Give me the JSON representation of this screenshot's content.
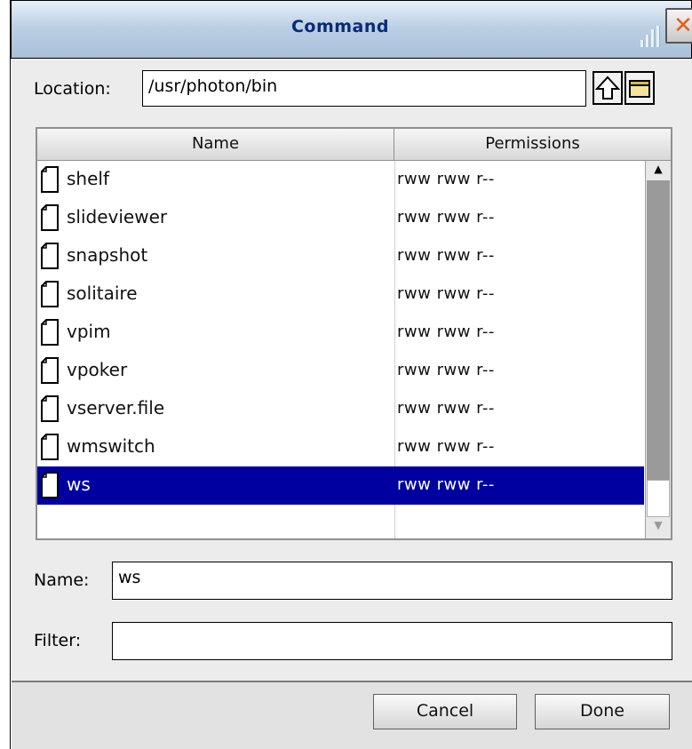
{
  "window": {
    "title": "Command"
  },
  "location": {
    "label": "Location:",
    "value": "/usr/photon/bin"
  },
  "columns": {
    "name": "Name",
    "permissions": "Permissions"
  },
  "files": [
    {
      "name": "shelf",
      "perm": "rww rww r--"
    },
    {
      "name": "slideviewer",
      "perm": "rww rww r--"
    },
    {
      "name": "snapshot",
      "perm": "rww rww r--"
    },
    {
      "name": "solitaire",
      "perm": "rww rww r--"
    },
    {
      "name": "vpim",
      "perm": "rww rww r--"
    },
    {
      "name": "vpoker",
      "perm": "rww rww r--"
    },
    {
      "name": "vserver.file",
      "perm": "rww rww r--"
    },
    {
      "name": "wmswitch",
      "perm": "rww rww r--"
    },
    {
      "name": "ws",
      "perm": "rww rww r--"
    }
  ],
  "selected_index": 8,
  "name_field": {
    "label": "Name:",
    "value": "ws"
  },
  "filter_field": {
    "label": "Filter:",
    "value": ""
  },
  "buttons": {
    "cancel": "Cancel",
    "done": "Done"
  },
  "colors": {
    "selection": "#0000a0",
    "title_text": "#0a2a7a",
    "close_x": "#e0601a"
  },
  "icons": [
    "up-arrow-icon",
    "folder-icon",
    "close-icon",
    "file-icon",
    "scroll-up-icon",
    "scroll-down-icon"
  ]
}
